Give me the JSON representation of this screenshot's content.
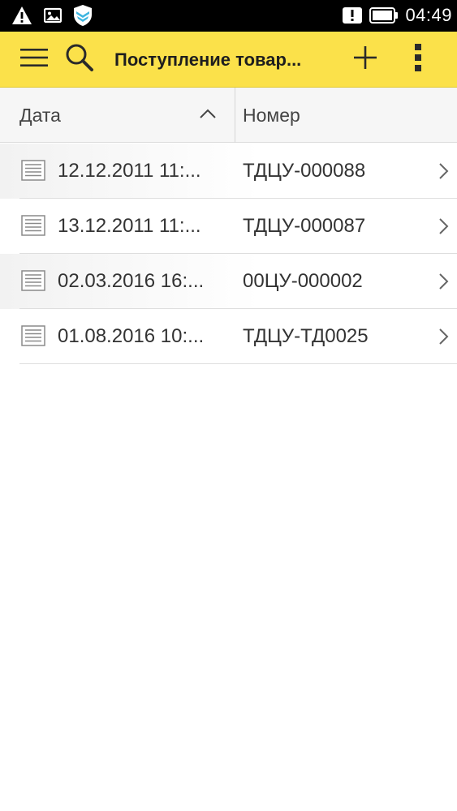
{
  "status_bar": {
    "time": "04:49",
    "icons_left": [
      "warning-icon",
      "image-icon",
      "shield-icon"
    ],
    "icons_right": [
      "alert-icon",
      "battery-icon"
    ]
  },
  "app_bar": {
    "title": "Поступление товар...",
    "background": "#fbe14a",
    "icons": [
      "menu-icon",
      "search-icon",
      "plus-icon",
      "more-vertical-icon"
    ]
  },
  "table": {
    "columns": [
      {
        "label": "Дата",
        "sort": "ascending"
      },
      {
        "label": "Номер"
      }
    ],
    "rows": [
      {
        "date": "12.12.2011 11:...",
        "number": "ТДЦУ-000088"
      },
      {
        "date": "13.12.2011 11:...",
        "number": "ТДЦУ-000087"
      },
      {
        "date": "02.03.2016 16:...",
        "number": "00ЦУ-000002"
      },
      {
        "date": "01.08.2016 10:...",
        "number": "ТДЦУ-ТД0025"
      }
    ]
  }
}
